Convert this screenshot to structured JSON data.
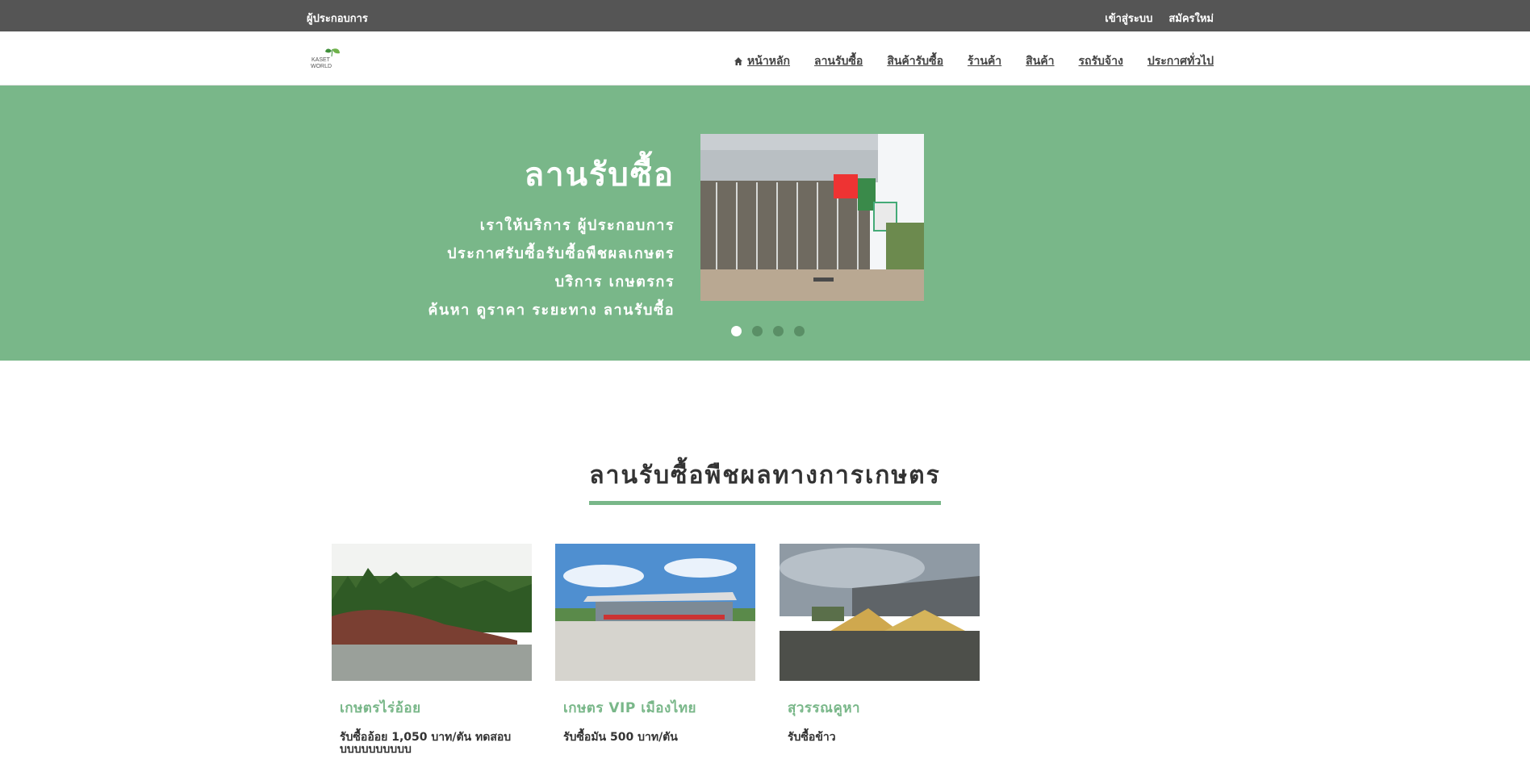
{
  "topbar": {
    "left_label": "ผู้ประกอบการ",
    "login_label": "เข้าสู่ระบบ",
    "register_label": "สมัครใหม่"
  },
  "logo": {
    "alt": "KASET WORLD",
    "line1": "KASET",
    "line2": "WORLD"
  },
  "nav": {
    "home": "หน้าหลัก",
    "yards": "ลานรับซื้อ",
    "buy_products": "สินค้ารับซื้อ",
    "shops": "ร้านค้า",
    "products": "สินค้า",
    "trucks": "รถรับจ้าง",
    "announcements": "ประกาศทั่วไป"
  },
  "hero": {
    "title": "ลานรับซื้อ",
    "lines": [
      "เราให้บริการ ผู้ประกอบการ",
      "ประกาศรับซื้อรับซื้อพืชผลเกษตร",
      "บริการ เกษตรกร",
      "ค้นหา ดูราคา ระยะทาง ลานรับซื้อ"
    ],
    "active_slide": 1,
    "slide_count": 4
  },
  "section": {
    "title": "ลานรับซื้อพืชผลทางการเกษตร"
  },
  "cards": [
    {
      "name": "เกษตรไร่อ้อย",
      "desc": "รับซื้ออ้อย 1,050 บาท/ตัน ทดสอบบบบบบบบบบบ"
    },
    {
      "name": "เกษตร VIP เมืองไทย",
      "desc": "รับซื้อมัน 500 บาท/ตัน"
    },
    {
      "name": "สุวรรณคูหา",
      "desc": "รับซื้อข้าว"
    }
  ],
  "colors": {
    "accent": "#79b789",
    "topbar": "#555555"
  }
}
